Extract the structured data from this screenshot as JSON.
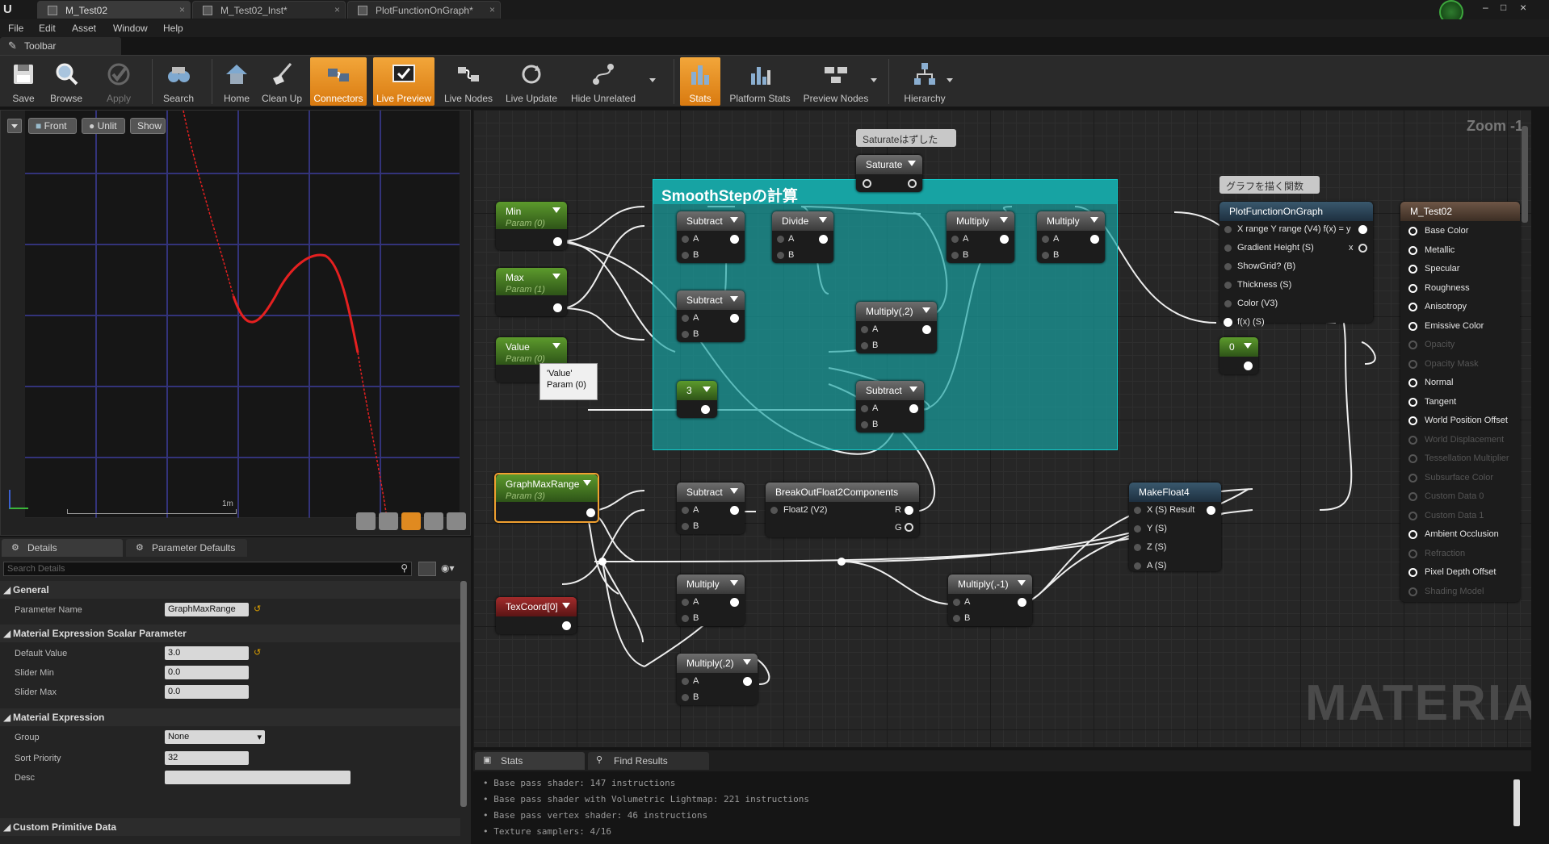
{
  "tabs": [
    {
      "label": "M_Test02"
    },
    {
      "label": "M_Test02_Inst*"
    },
    {
      "label": "PlotFunctionOnGraph*"
    }
  ],
  "menu": [
    "File",
    "Edit",
    "Asset",
    "Window",
    "Help"
  ],
  "toolbar_tab": "Toolbar",
  "toolbar": {
    "save": "Save",
    "browse": "Browse",
    "apply": "Apply",
    "search": "Search",
    "home": "Home",
    "cleanup": "Clean Up",
    "connectors": "Connectors",
    "live_preview": "Live Preview",
    "live_nodes": "Live Nodes",
    "live_update": "Live Update",
    "hide_unrelated": "Hide Unrelated",
    "stats": "Stats",
    "platform_stats": "Platform Stats",
    "preview_nodes": "Preview Nodes",
    "hierarchy": "Hierarchy"
  },
  "viewport": {
    "front": "Front",
    "unlit": "Unlit",
    "show": "Show",
    "scale_label": "1m"
  },
  "details": {
    "tab1": "Details",
    "tab2": "Parameter Defaults",
    "search_placeholder": "Search Details",
    "general": "General",
    "param_name_label": "Parameter Name",
    "param_name_value": "GraphMaxRange",
    "scalar_section": "Material Expression Scalar Parameter",
    "default_value_label": "Default Value",
    "default_value": "3.0",
    "slider_min_label": "Slider Min",
    "slider_min": "0.0",
    "slider_max_label": "Slider Max",
    "slider_max": "0.0",
    "expr_section": "Material Expression",
    "group_label": "Group",
    "group_value": "None",
    "sort_label": "Sort Priority",
    "sort_value": "32",
    "desc_label": "Desc",
    "custom_section": "Custom Primitive Data"
  },
  "graph": {
    "zoom": "Zoom -1",
    "watermark": "MATERIAL",
    "comment_title": "SmoothStepの計算",
    "comment_saturate": "Saturateはずした",
    "comment_graph": "グラフを描く関数",
    "tooltip_line1": "'Value'",
    "tooltip_line2": "Param (0)"
  },
  "nodes": {
    "min": {
      "title": "Min",
      "sub": "Param (0)"
    },
    "max": {
      "title": "Max",
      "sub": "Param (1)"
    },
    "value": {
      "title": "Value",
      "sub": "Param (0)"
    },
    "gmr": {
      "title": "GraphMaxRange",
      "sub": "Param (3)"
    },
    "texcoord": {
      "title": "TexCoord[0]"
    },
    "saturate": {
      "title": "Saturate"
    },
    "sub1": {
      "title": "Subtract"
    },
    "sub2": {
      "title": "Subtract"
    },
    "divide": {
      "title": "Divide"
    },
    "mul1": {
      "title": "Multiply"
    },
    "mul2": {
      "title": "Multiply"
    },
    "mul_2": {
      "title": "Multiply(,2)"
    },
    "three": {
      "title": "3"
    },
    "sub3": {
      "title": "Subtract"
    },
    "sub4": {
      "title": "Subtract"
    },
    "breakout": {
      "title": "BreakOutFloat2Components",
      "in": "Float2 (V2)",
      "r": "R",
      "g": "G"
    },
    "mul3": {
      "title": "Multiply"
    },
    "mul_2b": {
      "title": "Multiply(,2)"
    },
    "mul_neg": {
      "title": "Multiply(,-1)"
    },
    "makefloat4": {
      "title": "MakeFloat4",
      "x": "X (S) Result",
      "y": "Y (S)",
      "z": "Z (S)",
      "w": "A (S)"
    },
    "plot": {
      "title": "PlotFunctionOnGraph",
      "p1": "X range Y range (V4) f(x) = y",
      "p2": "Gradient Height (S)",
      "p2o": "x",
      "p3": "ShowGrid? (B)",
      "p4": "Thickness (S)",
      "p5": "Color (V3)",
      "p6": "f(x) (S)"
    },
    "zero": {
      "title": "0"
    },
    "material": {
      "title": "M_Test02"
    }
  },
  "pin_a": "A",
  "pin_b": "B",
  "material_pins": [
    {
      "label": "Base Color",
      "active": true
    },
    {
      "label": "Metallic",
      "active": true
    },
    {
      "label": "Specular",
      "active": true
    },
    {
      "label": "Roughness",
      "active": true
    },
    {
      "label": "Anisotropy",
      "active": true
    },
    {
      "label": "Emissive Color",
      "active": true
    },
    {
      "label": "Opacity",
      "active": false
    },
    {
      "label": "Opacity Mask",
      "active": false
    },
    {
      "label": "Normal",
      "active": true
    },
    {
      "label": "Tangent",
      "active": true
    },
    {
      "label": "World Position Offset",
      "active": true
    },
    {
      "label": "World Displacement",
      "active": false
    },
    {
      "label": "Tessellation Multiplier",
      "active": false
    },
    {
      "label": "Subsurface Color",
      "active": false
    },
    {
      "label": "Custom Data 0",
      "active": false
    },
    {
      "label": "Custom Data 1",
      "active": false
    },
    {
      "label": "Ambient Occlusion",
      "active": true
    },
    {
      "label": "Refraction",
      "active": false
    },
    {
      "label": "Pixel Depth Offset",
      "active": true
    },
    {
      "label": "Shading Model",
      "active": false
    }
  ],
  "stats_panel": {
    "tab1": "Stats",
    "tab2": "Find Results",
    "lines": [
      "• Base pass shader: 147 instructions",
      "• Base pass shader with Volumetric Lightmap: 221 instructions",
      "• Base pass vertex shader: 46 instructions",
      "• Texture samplers: 4/16"
    ]
  },
  "colors": {
    "accent": "#f0a030",
    "comment": "#17a3a3",
    "curve": "#e52020"
  }
}
